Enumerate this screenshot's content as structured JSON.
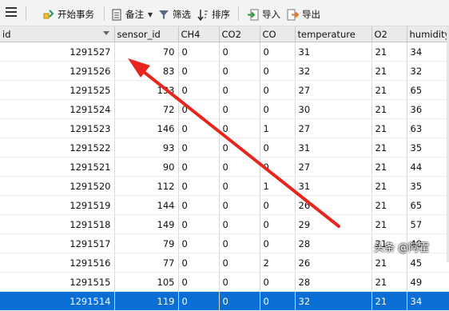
{
  "toolbar": {
    "begin_transaction": "开始事务",
    "note": "备注",
    "filter": "筛选",
    "sort": "排序",
    "import": "导入",
    "export": "导出"
  },
  "columns": [
    "id",
    "sensor_id",
    "CH4",
    "CO2",
    "CO",
    "temperature",
    "O2",
    "humidity"
  ],
  "rows": [
    [
      "1291527",
      "70",
      "0",
      "0",
      "0",
      "31",
      "21",
      "34"
    ],
    [
      "1291526",
      "83",
      "0",
      "0",
      "0",
      "32",
      "21",
      "32"
    ],
    [
      "1291525",
      "133",
      "0",
      "0",
      "0",
      "27",
      "21",
      "65"
    ],
    [
      "1291524",
      "72",
      "0",
      "0",
      "0",
      "30",
      "21",
      "36"
    ],
    [
      "1291523",
      "146",
      "0",
      "0",
      "1",
      "27",
      "21",
      "63"
    ],
    [
      "1291522",
      "93",
      "0",
      "0",
      "0",
      "31",
      "21",
      "35"
    ],
    [
      "1291521",
      "90",
      "0",
      "0",
      "0",
      "27",
      "21",
      "44"
    ],
    [
      "1291520",
      "112",
      "0",
      "0",
      "1",
      "31",
      "21",
      "35"
    ],
    [
      "1291519",
      "144",
      "0",
      "0",
      "0",
      "26",
      "21",
      "65"
    ],
    [
      "1291518",
      "149",
      "0",
      "0",
      "0",
      "29",
      "21",
      "57"
    ],
    [
      "1291517",
      "79",
      "0",
      "0",
      "0",
      "28",
      "21",
      "40"
    ],
    [
      "1291516",
      "77",
      "0",
      "0",
      "2",
      "26",
      "21",
      "45"
    ],
    [
      "1291515",
      "105",
      "0",
      "0",
      "0",
      "28",
      "21",
      "49"
    ],
    [
      "1291514",
      "119",
      "0",
      "0",
      "0",
      "32",
      "21",
      "34"
    ]
  ],
  "selected_row": 13,
  "watermark": "头条 @阿霍",
  "colors": {
    "selection": "#0a6fd4",
    "annotation_arrow": "#e8241c"
  }
}
